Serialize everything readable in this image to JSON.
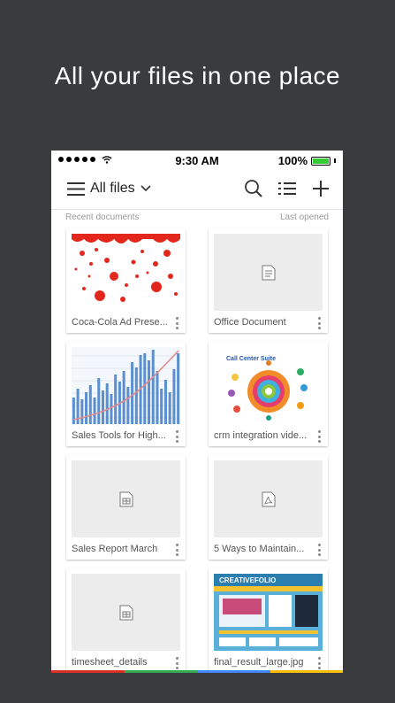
{
  "headline": "All your files in one place",
  "status_bar": {
    "time": "9:30 AM",
    "battery": "100%"
  },
  "toolbar": {
    "title": "All files",
    "icons": [
      "menu-icon",
      "chevron-down-icon",
      "search-icon",
      "list-view-icon",
      "add-icon"
    ]
  },
  "list_header": {
    "left": "Recent documents",
    "right": "Last opened"
  },
  "files": [
    {
      "name": "Coca-Cola Ad Prese...",
      "thumb": "bubbles"
    },
    {
      "name": "Office Document",
      "thumb": "doc-icon"
    },
    {
      "name": "Sales Tools for High...",
      "thumb": "bar-chart"
    },
    {
      "name": "crm integration vide...",
      "thumb": "crm-diagram"
    },
    {
      "name": "Sales Report March",
      "thumb": "sheet-icon"
    },
    {
      "name": "5 Ways to Maintain...",
      "thumb": "pdf-icon"
    },
    {
      "name": "timesheet_details",
      "thumb": "sheet-icon"
    },
    {
      "name": "final_result_large.jpg",
      "thumb": "website"
    }
  ],
  "crm_thumb_title": "Call Center Suite",
  "website_thumb_title": "CREATIVEFOLIO",
  "colors": {
    "background": "#3a3b3d",
    "accent_bar": [
      "#d93025",
      "#34a853",
      "#4285f4",
      "#fbbc05"
    ]
  }
}
